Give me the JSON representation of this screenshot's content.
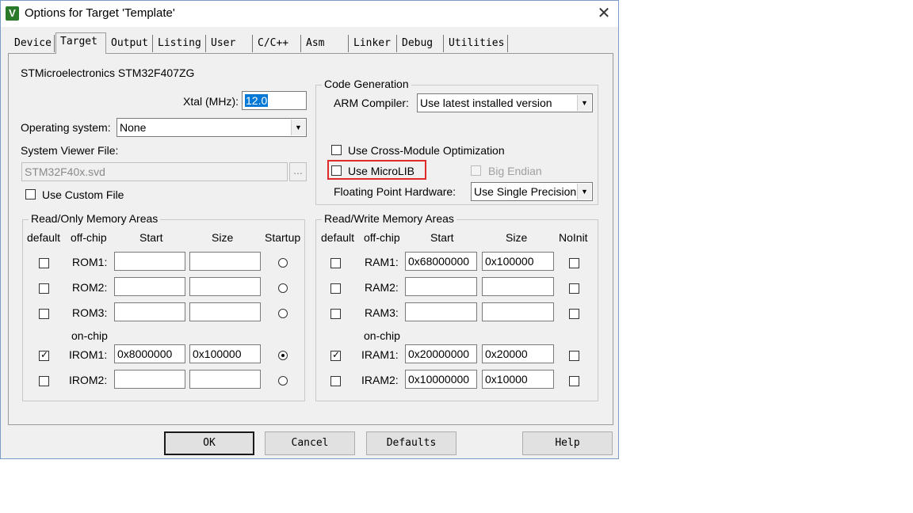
{
  "window": {
    "title": "Options for Target 'Template'",
    "icon": "keil-app-icon",
    "close": "✕"
  },
  "tabs": [
    {
      "label": "Device"
    },
    {
      "label": "Target"
    },
    {
      "label": "Output"
    },
    {
      "label": "Listing"
    },
    {
      "label": "User"
    },
    {
      "label": "C/C++"
    },
    {
      "label": "Asm"
    },
    {
      "label": "Linker"
    },
    {
      "label": "Debug"
    },
    {
      "label": "Utilities"
    }
  ],
  "active_tab": "Target",
  "target": {
    "device": "STMicroelectronics STM32F407ZG",
    "xtal_label": "Xtal (MHz):",
    "xtal_value": "12.0",
    "os_label": "Operating system:",
    "os_value": "None",
    "svd_label": "System Viewer File:",
    "svd_value": "STM32F40x.svd",
    "browse_label": "...",
    "custom_file_label": "Use Custom File"
  },
  "code_gen": {
    "title": "Code Generation",
    "compiler_label": "ARM Compiler:",
    "compiler_value": "Use latest installed version",
    "cross_module_label": "Use Cross-Module Optimization",
    "microlib_label": "Use MicroLIB",
    "big_endian_label": "Big Endian",
    "fpu_label": "Floating Point Hardware:",
    "fpu_value": "Use Single Precision",
    "highlight_color": "#e02a2a"
  },
  "rom": {
    "title": "Read/Only Memory Areas",
    "headers": {
      "default": "default",
      "offchip": "off-chip",
      "start": "Start",
      "size": "Size",
      "startup": "Startup"
    },
    "onchip_label": "on-chip",
    "rows": [
      {
        "name": "ROM1:",
        "default": false,
        "start": "",
        "size": "",
        "startup": false
      },
      {
        "name": "ROM2:",
        "default": false,
        "start": "",
        "size": "",
        "startup": false
      },
      {
        "name": "ROM3:",
        "default": false,
        "start": "",
        "size": "",
        "startup": false
      },
      {
        "name": "IROM1:",
        "default": true,
        "start": "0x8000000",
        "size": "0x100000",
        "startup": true
      },
      {
        "name": "IROM2:",
        "default": false,
        "start": "",
        "size": "",
        "startup": false
      }
    ]
  },
  "ram": {
    "title": "Read/Write Memory Areas",
    "headers": {
      "default": "default",
      "offchip": "off-chip",
      "start": "Start",
      "size": "Size",
      "noinit": "NoInit"
    },
    "onchip_label": "on-chip",
    "rows": [
      {
        "name": "RAM1:",
        "default": false,
        "start": "0x68000000",
        "size": "0x100000",
        "noinit": false
      },
      {
        "name": "RAM2:",
        "default": false,
        "start": "",
        "size": "",
        "noinit": false
      },
      {
        "name": "RAM3:",
        "default": false,
        "start": "",
        "size": "",
        "noinit": false
      },
      {
        "name": "IRAM1:",
        "default": true,
        "start": "0x20000000",
        "size": "0x20000",
        "noinit": false
      },
      {
        "name": "IRAM2:",
        "default": false,
        "start": "0x10000000",
        "size": "0x10000",
        "noinit": false
      }
    ]
  },
  "buttons": {
    "ok": "OK",
    "cancel": "Cancel",
    "defaults": "Defaults",
    "help": "Help"
  }
}
